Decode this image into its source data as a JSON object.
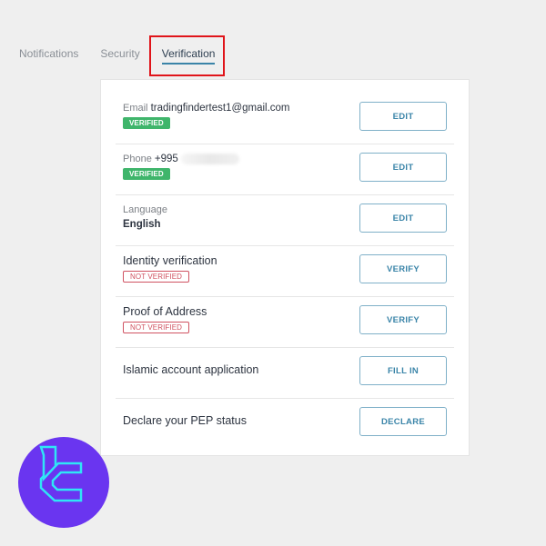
{
  "tabs": [
    {
      "label": "Notifications",
      "active": false
    },
    {
      "label": "Security",
      "active": false
    },
    {
      "label": "Verification",
      "active": true
    }
  ],
  "rows": [
    {
      "label": "Email",
      "value": "tradingfindertest1@gmail.com",
      "badge": "VERIFIED",
      "badge_status": "verified",
      "button": "EDIT"
    },
    {
      "label": "Phone",
      "value": "+995",
      "value_redacted": true,
      "badge": "VERIFIED",
      "badge_status": "verified",
      "button": "EDIT"
    },
    {
      "label": "Language",
      "value": "English",
      "button": "EDIT"
    },
    {
      "label": "Identity verification",
      "badge": "NOT VERIFIED",
      "badge_status": "not-verified",
      "button": "VERIFY"
    },
    {
      "label": "Proof of Address",
      "badge": "NOT VERIFIED",
      "badge_status": "not-verified",
      "button": "VERIFY"
    },
    {
      "label": "Islamic account application",
      "button": "FILL IN"
    },
    {
      "label": "Declare your PEP status",
      "button": "DECLARE"
    }
  ],
  "colors": {
    "accent": "#3a84a8",
    "verified": "#3fb56b",
    "not_verified": "#d05261",
    "highlight": "#e0141a",
    "logo_bg": "#6a35f0",
    "logo_fg": "#2fe6f5"
  },
  "logo": {
    "icon": "tradingfinder-logo"
  }
}
